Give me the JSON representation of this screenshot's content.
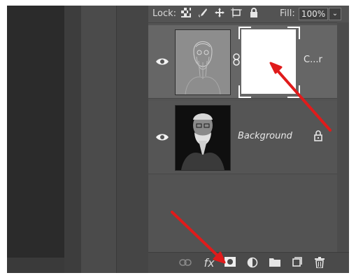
{
  "lock_bar": {
    "lock_label": "Lock:",
    "fill_label": "Fill:",
    "fill_value": "100%",
    "icons": [
      "lock-transparent-pixels-icon",
      "lock-image-pixels-icon",
      "lock-position-icon",
      "lock-artboard-icon",
      "lock-all-icon"
    ]
  },
  "layers": [
    {
      "name": "C...r",
      "thumbnail": "sketch-portrait",
      "has_mask": true,
      "visible": true
    },
    {
      "name": "Background",
      "thumbnail": "photo-portrait",
      "locked": true,
      "visible": true
    }
  ],
  "bottom_bar": {
    "icons": [
      "link-layers-icon",
      "fx-icon",
      "add-mask-icon",
      "adjustment-layer-icon",
      "group-folder-icon",
      "new-layer-icon",
      "delete-icon"
    ],
    "fx_label": "fx"
  },
  "colors": {
    "panel": "#535353",
    "arrow": "#e01b1b"
  }
}
